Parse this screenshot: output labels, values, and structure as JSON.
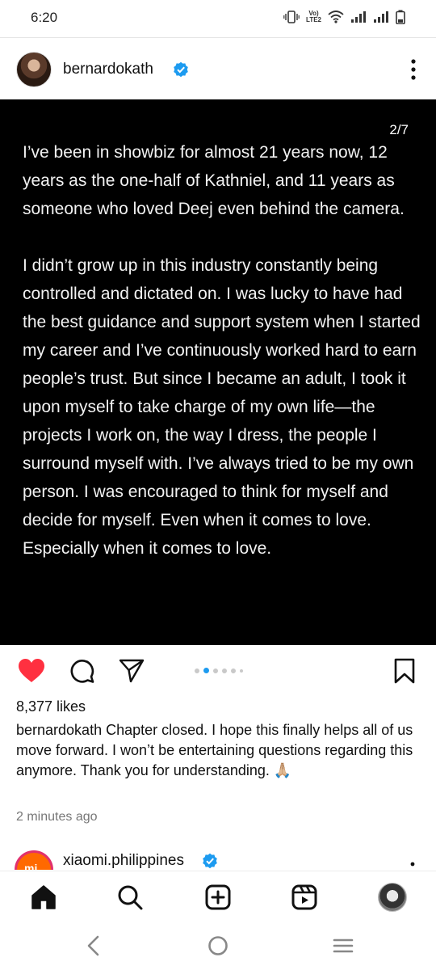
{
  "status_bar": {
    "time": "6:20",
    "volte_label_1": "Vo)",
    "volte_label_2": "LTE2"
  },
  "post": {
    "username": "bernardokath",
    "image": {
      "page_counter": "2/7",
      "text": "I’ve been in showbiz for almost 21 years now, 12 years as the one-half of Kathniel, and 11 years as someone who loved Deej even behind the camera.\n\nI didn’t grow up in this industry constantly being controlled and dictated on. I was lucky to have had the best guidance and support system when I started my career and I’ve continuously worked hard to earn people’s trust. But since I became an adult, I took it upon myself to take charge of my own life—the projects I work on, the way I dress, the people I surround myself with. I’ve always tried to be my own person. I was encouraged to think for myself and decide for myself. Even when it comes to love. Especially when it comes to love."
    },
    "carousel": {
      "total": 7,
      "current": 2
    },
    "likes": "8,377 likes",
    "caption_user": "bernardokath",
    "caption_text": " Chapter closed. I hope this finally helps all of us move forward. I won’t be entertaining questions regarding this anymore. Thank you for understanding. 🙏🏼",
    "timestamp": "2 minutes ago",
    "liked": true,
    "accent_like": "#ff3040"
  },
  "next_post": {
    "avatar_label": "mi",
    "username": "xiaomi.philippines"
  },
  "colors": {
    "verified": "#1d9bf0",
    "image_bg": "#000000",
    "active_dot": "#1d9bf0"
  },
  "icons": {
    "like": "heart-icon",
    "comment": "comment-icon",
    "share": "paper-plane-icon",
    "save": "bookmark-icon",
    "home": "home-icon",
    "search": "search-icon",
    "create": "plus-square-icon",
    "reels": "reels-icon",
    "back": "back-chevron-icon",
    "home_sys": "circle-home-icon",
    "menu": "menu-icon"
  }
}
